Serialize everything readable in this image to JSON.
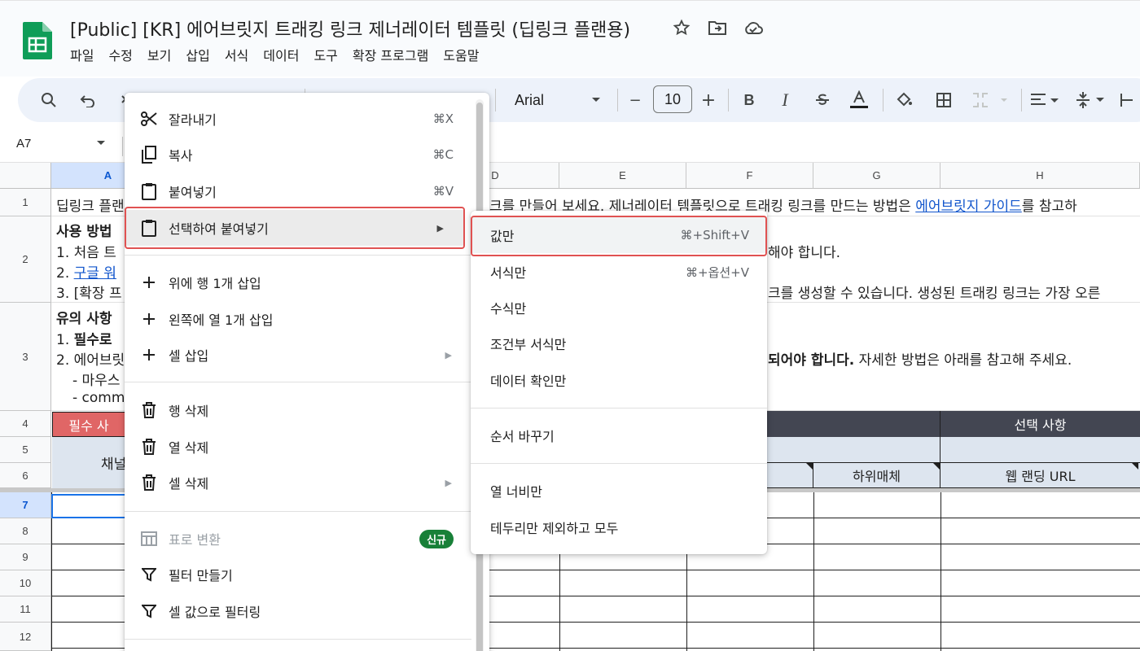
{
  "app": {
    "title": "[Public] [KR] 에어브릿지 트래킹 링크 제너레이터 템플릿 (딥링크 플랜용)",
    "menu": [
      "파일",
      "수정",
      "보기",
      "삽입",
      "서식",
      "데이터",
      "도구",
      "확장 프로그램",
      "도움말"
    ],
    "accent": "#0b57d0"
  },
  "toolbar": {
    "font": "Arial",
    "font_size": "10",
    "minus": "−",
    "plus": "+",
    "bold": "B",
    "italic": "I"
  },
  "formula_bar": {
    "cell_ref": "A7"
  },
  "grid": {
    "columns": [
      "A",
      "D",
      "E",
      "F",
      "G",
      "H"
    ],
    "rows": [
      "1",
      "2",
      "3",
      "4",
      "5",
      "6",
      "7",
      "8",
      "9",
      "10",
      "11",
      "12"
    ],
    "row1_left": "딥링크 플랜",
    "row1_right_a": "크를 만들어 보세요. 제너레이터 템플릿으로 트래킹 링크를 만드는 방법은 ",
    "row1_link": "에어브릿지 가이드",
    "row1_right_b": "를 참고하",
    "row2_l1": "사용 방법",
    "row2_l2": "1. 처음 트",
    "row2_l3a": "2. ",
    "row2_l3_link": "구글 워",
    "row2_l4": "3. [확장 프",
    "row2_right1": "해야 합니다.",
    "row2_right2": "크를 생성할 수 있습니다. 생성된 트래킹 링크는 가장 오른",
    "row3_l1": "유의 사항",
    "row3_l2a": "1. ",
    "row3_l2b": "필수로 ",
    "row3_l3": "2. 에어브릿",
    "row3_l4": "- 마우스",
    "row3_l5": "- comm",
    "row3_right_bold": "되어야 합니다.",
    "row3_right": " 자세한 방법은 아래를 참고해 주세요.",
    "row4_required": "필수 사",
    "row4_optional": "선택 사항",
    "row5_channel": "채널",
    "row6_sub": "하위매체",
    "row6_url": "웹 랜딩 URL"
  },
  "context_menu": {
    "cut": {
      "label": "잘라내기",
      "shortcut": "⌘X"
    },
    "copy": {
      "label": "복사",
      "shortcut": "⌘C"
    },
    "paste": {
      "label": "붙여넣기",
      "shortcut": "⌘V"
    },
    "paste_special": {
      "label": "선택하여 붙여넣기",
      "arrow": "▶"
    },
    "insert_row": {
      "label": "위에 행 1개 삽입"
    },
    "insert_col": {
      "label": "왼쪽에 열 1개 삽입"
    },
    "insert_cells": {
      "label": "셀 삽입",
      "arrow": "▶"
    },
    "delete_row": {
      "label": "행 삭제"
    },
    "delete_col": {
      "label": "열 삭제"
    },
    "delete_cells": {
      "label": "셀 삭제",
      "arrow": "▶"
    },
    "convert_table": {
      "label": "표로 변환",
      "badge": "신규"
    },
    "create_filter": {
      "label": "필터 만들기"
    },
    "filter_by_value": {
      "label": "셀 값으로 필터링"
    }
  },
  "paste_special_menu": {
    "values_only": {
      "label": "값만",
      "shortcut": "⌘+Shift+V"
    },
    "format_only": {
      "label": "서식만",
      "shortcut": "⌘+옵션+V"
    },
    "formula_only": {
      "label": "수식만"
    },
    "conditional_only": {
      "label": "조건부 서식만"
    },
    "validation_only": {
      "label": "데이터 확인만"
    },
    "transpose": {
      "label": "순서 바꾸기"
    },
    "col_width_only": {
      "label": "열 너비만"
    },
    "all_except_borders": {
      "label": "테두리만 제외하고 모두"
    }
  }
}
